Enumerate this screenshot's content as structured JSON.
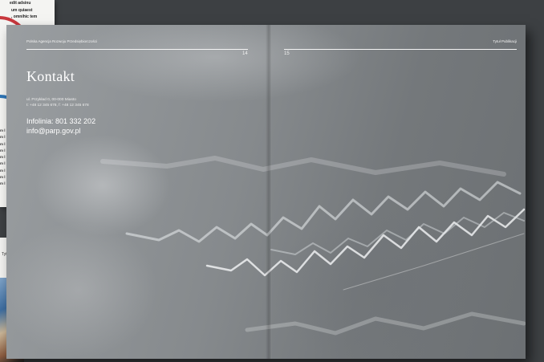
{
  "background": {
    "top_page_snippets": [
      "edit adsinu",
      "um quiaest",
      ", omnihic tem"
    ],
    "top_page_lines": [
      "m l",
      "m l",
      "m l",
      "m l",
      "m l",
      "m l",
      "m l",
      "m l",
      "m l"
    ],
    "bottom_page_snippet": "Tyt"
  },
  "spread": {
    "left_page": {
      "header": "Polska Agencja Rozwoju Przedsiębiorczości",
      "page_number": "14",
      "title": "Kontakt",
      "address_line1": "ul. Przykład 0, 00-000 Miasto",
      "address_line2": "t: +48 12 345 678, f: +48 12 345 678",
      "hotline": "Infolinia: 801 332 202",
      "email": "info@parp.gov.pl"
    },
    "right_page": {
      "header": "Tytuł Publikacji",
      "page_number": "15"
    }
  },
  "colors": {
    "spread_gray": "#868a8d",
    "text": "#ffffff",
    "desk": "#3d4043",
    "accent_red": "#c8373d",
    "accent_blue": "#2d74b5"
  }
}
